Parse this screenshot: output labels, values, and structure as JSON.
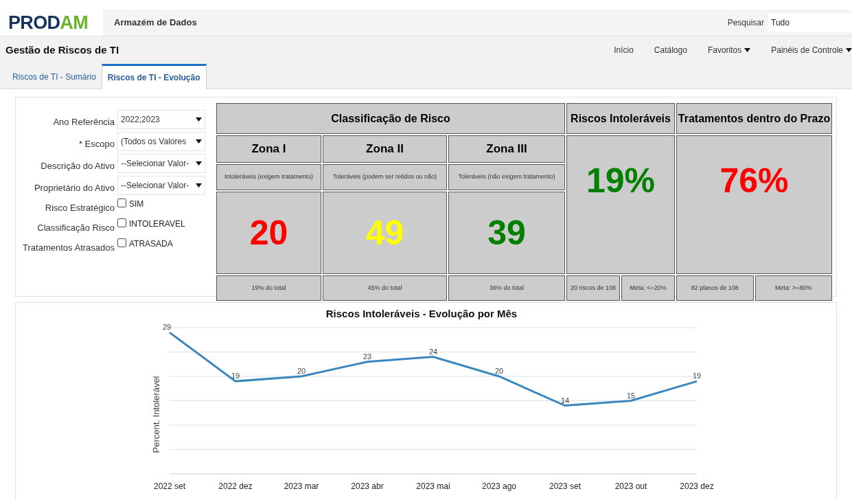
{
  "header": {
    "logo": "PRODAM",
    "app_title": "Armazém de Dados",
    "search_label": "Pesquisar",
    "search_value": "Tudo"
  },
  "page_title": "Gestão de Riscos de TI",
  "nav": [
    {
      "label": "Início",
      "dropdown": false
    },
    {
      "label": "Catálogo",
      "dropdown": false
    },
    {
      "label": "Favoritos",
      "dropdown": true
    },
    {
      "label": "Painéis de Controle",
      "dropdown": true
    }
  ],
  "tabs": [
    {
      "label": "Riscos de TI - Sumário",
      "selected": false
    },
    {
      "label": "Riscos de TI - Evolução",
      "selected": true
    }
  ],
  "filters": [
    {
      "kind": "select",
      "label": "Ano Referência",
      "value": "2022;2023"
    },
    {
      "kind": "select",
      "label": "* Escopo",
      "value": "(Todos os Valores"
    },
    {
      "kind": "select",
      "label": "Descrição do Ativo",
      "value": "--Selecionar Valor-"
    },
    {
      "kind": "select",
      "label": "Proprietário do Ativo",
      "value": "--Selecionar Valor-"
    },
    {
      "kind": "checkbox",
      "label": "Risco Estratégico",
      "option": "SIM",
      "checked": false
    },
    {
      "kind": "checkbox",
      "label": "Classificação Risco",
      "option": "INTOLERAVEL",
      "checked": false
    },
    {
      "kind": "checkbox",
      "label": "Tratamentos Atrasados",
      "option": "ATRASADA",
      "checked": false
    }
  ],
  "classification": {
    "title": "Classificação de Risco",
    "zones": [
      {
        "name": "Zona I",
        "description": "Intoleráveis (exigem tratamento)",
        "value": "20",
        "color": "#ff0000",
        "share": "19% do total"
      },
      {
        "name": "Zona II",
        "description": "Toleráveis (podem ser retidos ou não)",
        "value": "49",
        "color": "#ffff00",
        "share": "45% do total"
      },
      {
        "name": "Zona III",
        "description": "Toleráveis (não exigem tratamento)",
        "value": "39",
        "color": "#008000",
        "share": "36% do total"
      }
    ]
  },
  "kpis": [
    {
      "title": "Riscos Intoleráveis",
      "value": "19%",
      "color": "#008000",
      "detail": "20 riscos de 108",
      "goal": "Meta: <=20%"
    },
    {
      "title": "Tratamentos dentro do Prazo",
      "value": "76%",
      "color": "#ff0000",
      "detail": "82 planos de 108",
      "goal": "Meta: >=80%"
    }
  ],
  "chart": {
    "chart_data": {
      "type": "line",
      "title": "Riscos Intoleráveis - Evolução por Mês",
      "ylabel": "Percent. Intolerável",
      "categories": [
        "2022 set",
        "2022 dez",
        "2023 mar",
        "2023 abr",
        "2023 mai",
        "2023 ago",
        "2023 set",
        "2023 out",
        "2023 dez"
      ],
      "ylim": [
        0,
        30
      ],
      "data_labels": true,
      "series": [
        {
          "color": "#3a87c0",
          "values": [
            29,
            19,
            20,
            23,
            24,
            20,
            14,
            15,
            19
          ]
        }
      ]
    }
  }
}
